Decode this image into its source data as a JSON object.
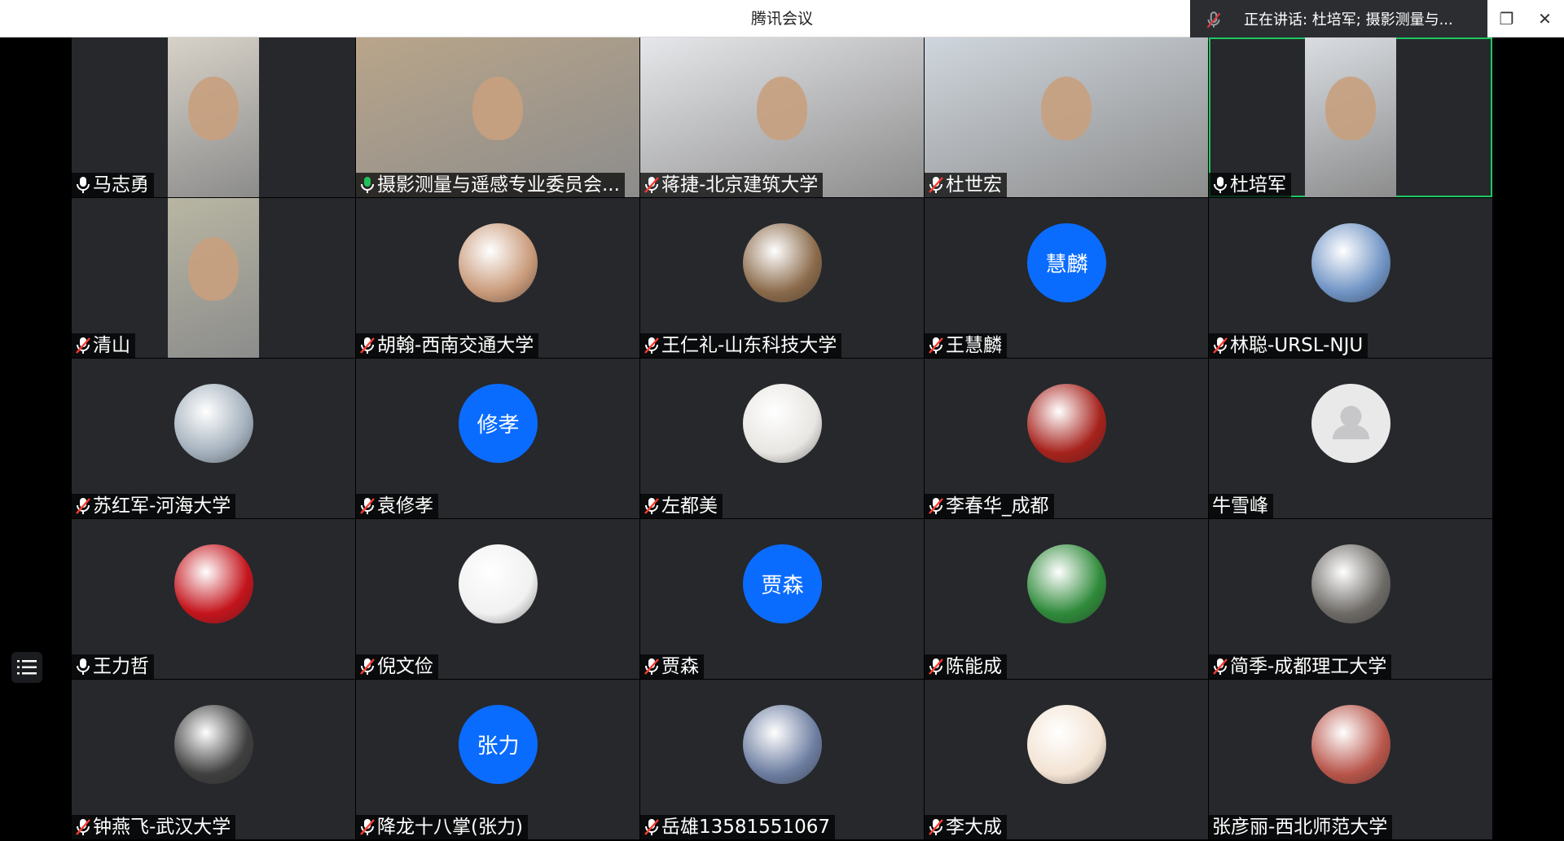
{
  "window": {
    "title": "腾讯会议",
    "restore_label": "❐",
    "close_label": "✕"
  },
  "speaker_banner": {
    "text": "正在讲话: 杜培军; 摄影测量与..."
  },
  "participants": [
    {
      "name": "马志勇",
      "mic": "on",
      "type": "video",
      "color": "#d7d2c8"
    },
    {
      "name": "摄影测量与遥感专业委员会...",
      "mic": "on-green",
      "type": "video",
      "color": "#b9a58a"
    },
    {
      "name": "蒋捷-北京建筑大学",
      "mic": "off",
      "type": "video",
      "color": "#e6e7ea"
    },
    {
      "name": "杜世宏",
      "mic": "off",
      "type": "video",
      "color": "#cfd6dd"
    },
    {
      "name": "杜培军",
      "mic": "on",
      "type": "video",
      "color": "#d9dde2",
      "active": true
    },
    {
      "name": "清山",
      "mic": "off",
      "type": "video",
      "color": "#b8b6a2"
    },
    {
      "name": "胡翰-西南交通大学",
      "mic": "off",
      "type": "image",
      "color": "#c99a7a"
    },
    {
      "name": "王仁礼-山东科技大学",
      "mic": "off",
      "type": "image",
      "color": "#8a6a4a"
    },
    {
      "name": "王慧麟",
      "mic": "off",
      "type": "text",
      "avatar_text": "慧麟"
    },
    {
      "name": "林聪-URSL-NJU",
      "mic": "off",
      "type": "image",
      "color": "#6f93c4"
    },
    {
      "name": "苏红军-河海大学",
      "mic": "off",
      "type": "image",
      "color": "#a3b0bc"
    },
    {
      "name": "袁修孝",
      "mic": "off",
      "type": "text",
      "avatar_text": "修孝"
    },
    {
      "name": "左都美",
      "mic": "off",
      "type": "image",
      "color": "#e8e6e2"
    },
    {
      "name": "李春华_成都",
      "mic": "off",
      "type": "image",
      "color": "#a6221c"
    },
    {
      "name": "牛雪峰",
      "mic": "none",
      "type": "default"
    },
    {
      "name": "王力哲",
      "mic": "on",
      "type": "image",
      "color": "#c4141c"
    },
    {
      "name": "倪文俭",
      "mic": "off",
      "type": "image",
      "color": "#f1f1f1"
    },
    {
      "name": "贾森",
      "mic": "off",
      "type": "text",
      "avatar_text": "贾森"
    },
    {
      "name": "陈能成",
      "mic": "off",
      "type": "image",
      "color": "#2f8a3a"
    },
    {
      "name": "简季-成都理工大学",
      "mic": "off",
      "type": "image",
      "color": "#6d6a66"
    },
    {
      "name": "钟燕飞-武汉大学",
      "mic": "off",
      "type": "image",
      "color": "#3f3f3f"
    },
    {
      "name": "降龙十八掌(张力)",
      "mic": "off",
      "type": "text",
      "avatar_text": "张力"
    },
    {
      "name": "岳雄13581551067",
      "mic": "off",
      "type": "image",
      "color": "#6c7da0"
    },
    {
      "name": "李大成",
      "mic": "off",
      "type": "image",
      "color": "#f3e3d3"
    },
    {
      "name": "张彦丽-西北师范大学",
      "mic": "none",
      "type": "image",
      "color": "#b8554a"
    }
  ],
  "icons": {
    "mic_on": "mic-icon",
    "mic_off": "mic-muted-icon",
    "list": "list-icon",
    "default_avatar": "person-icon"
  }
}
